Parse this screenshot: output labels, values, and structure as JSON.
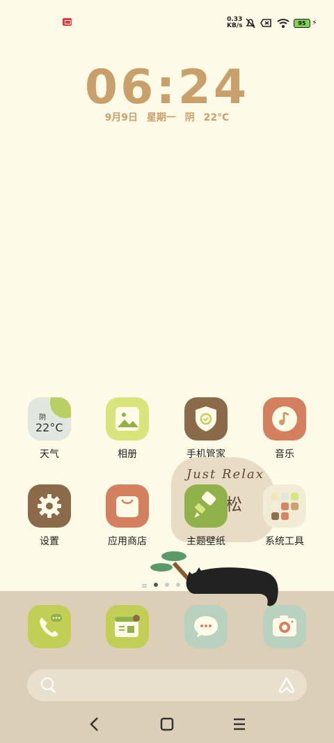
{
  "status_bar": {
    "net_speed_value": "0.33",
    "net_speed_unit": "KB/s",
    "battery": "95",
    "icons": [
      "notification-app-icon",
      "mute-icon",
      "no-sim-icon",
      "wifi-icon",
      "battery-icon",
      "charging-icon"
    ]
  },
  "clock": {
    "time": "06:24",
    "date": "9月9日",
    "weekday": "星期一",
    "weather": "阴",
    "temperature": "22°C"
  },
  "apps": [
    {
      "label": "天气",
      "widget_weather": "阴",
      "widget_temp": "22°C"
    },
    {
      "label": "相册"
    },
    {
      "label": "手机管家"
    },
    {
      "label": "音乐"
    },
    {
      "label": "设置"
    },
    {
      "label": "应用商店"
    },
    {
      "label": "主题壁纸"
    },
    {
      "label": "系统工具"
    }
  ],
  "decoration": {
    "relax_en": "Just Relax",
    "relax_cn": "轻松"
  },
  "pages": {
    "count": 3,
    "current": 1
  },
  "dock": [
    "phone-icon",
    "browser-icon",
    "messages-icon",
    "camera-icon"
  ],
  "colors": {
    "background": "#fdfbe8",
    "clock": "#c9a06a",
    "dock": "#dccfb8",
    "green": "#c2cf55",
    "mint": "#b9d2c0",
    "brown": "#8a6a48",
    "orange": "#d4805e"
  }
}
